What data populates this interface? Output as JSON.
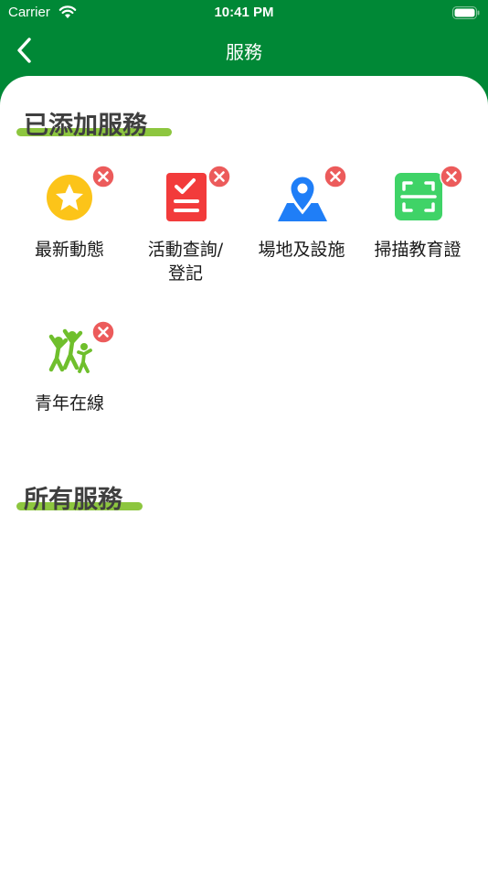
{
  "status_bar": {
    "carrier": "Carrier",
    "time": "10:41 PM"
  },
  "nav": {
    "title": "服務"
  },
  "sections": {
    "added_title": "已添加服務",
    "all_title": "所有服務"
  },
  "added_services": [
    {
      "label": "最新動態"
    },
    {
      "label": "活動查詢/\n登記"
    },
    {
      "label": "場地及設施"
    },
    {
      "label": "掃描教育證"
    },
    {
      "label": "青年在線"
    }
  ],
  "colors": {
    "header_green": "#008836",
    "accent_lime": "#8dc63f",
    "remove_red": "#ec5b5b",
    "news_yellow": "#fcc419",
    "activity_red": "#f23b3b",
    "venue_blue": "#1f7ef7",
    "scan_green": "#3fd367",
    "youth_green": "#6fbf2c"
  },
  "icons": [
    "chevron-left-icon",
    "wifi-icon",
    "battery-icon",
    "star-icon",
    "checklist-icon",
    "map-pin-icon",
    "scan-frame-icon",
    "people-icon",
    "close-icon"
  ]
}
